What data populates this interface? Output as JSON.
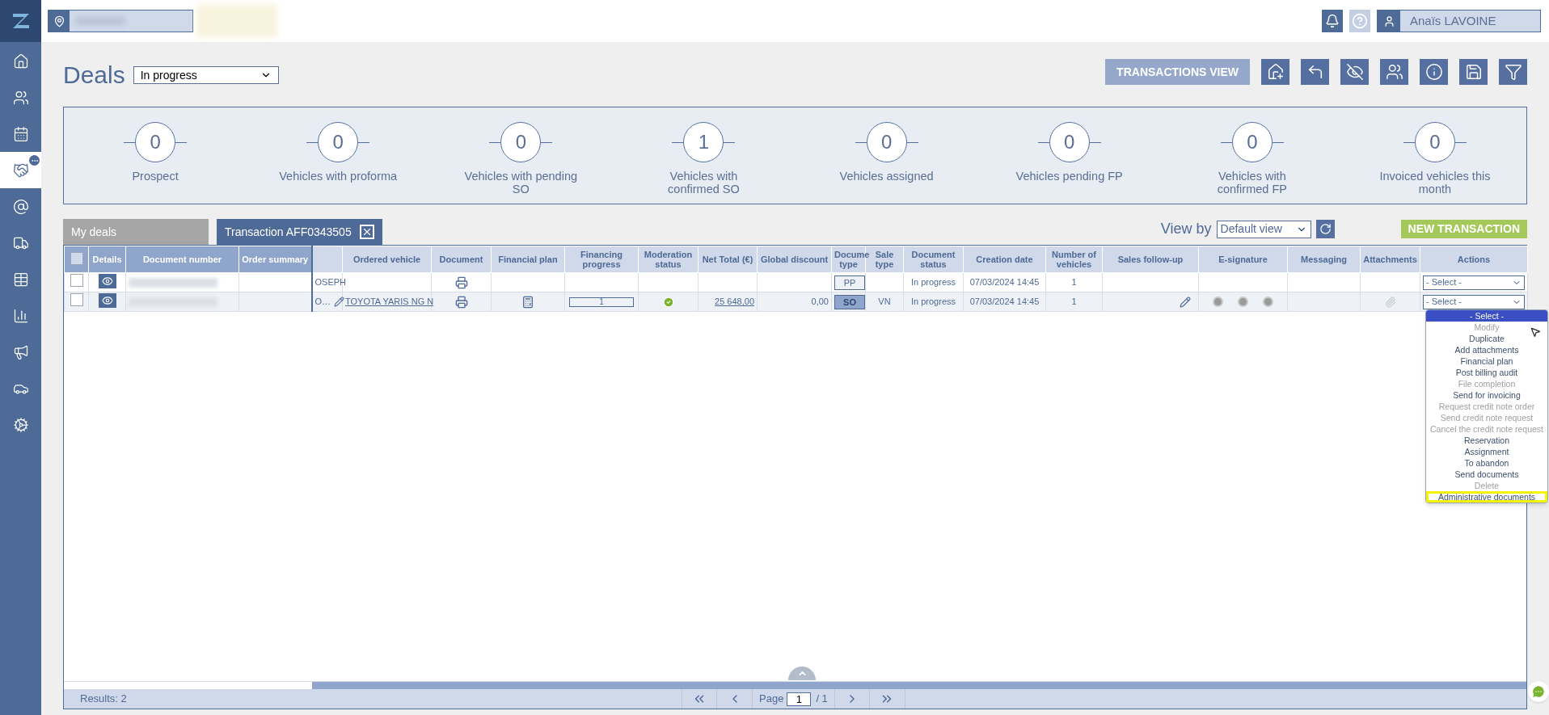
{
  "top_bar": {
    "user_name": "Anaïs LAVOINE"
  },
  "sidebar": {
    "items": [
      {
        "kind": "home",
        "selected": false
      },
      {
        "kind": "contacts",
        "selected": false
      },
      {
        "kind": "calendar",
        "selected": false
      },
      {
        "kind": "deals",
        "selected": true,
        "badge": true
      },
      {
        "kind": "mail",
        "selected": false
      },
      {
        "kind": "fleet",
        "selected": false
      },
      {
        "kind": "table",
        "selected": false
      },
      {
        "kind": "stats",
        "selected": false
      },
      {
        "kind": "marketing",
        "selected": false
      },
      {
        "kind": "vehicle",
        "selected": false
      },
      {
        "kind": "settings",
        "selected": false
      }
    ]
  },
  "header": {
    "title": "Deals",
    "status_filter": "In progress",
    "view_button": "TRANSACTIONS VIEW",
    "tools": [
      {
        "kind": "export"
      },
      {
        "kind": "back"
      },
      {
        "kind": "hide"
      },
      {
        "kind": "team"
      },
      {
        "kind": "info"
      },
      {
        "kind": "save"
      },
      {
        "kind": "filter"
      }
    ]
  },
  "stats": [
    {
      "count": "0",
      "label": "Prospect"
    },
    {
      "count": "0",
      "label": "Vehicles with proforma"
    },
    {
      "count": "0",
      "label": "Vehicles with pending SO"
    },
    {
      "count": "1",
      "label": "Vehicles with confirmed SO"
    },
    {
      "count": "0",
      "label": "Vehicles assigned"
    },
    {
      "count": "0",
      "label": "Vehicles pending FP"
    },
    {
      "count": "0",
      "label": "Vehicles with confirmed FP"
    },
    {
      "count": "0",
      "label": "Invoiced vehicles this month"
    }
  ],
  "tabs": [
    {
      "label": "My deals",
      "selected": false,
      "closable": false
    },
    {
      "label": "Transaction AFF0343505",
      "selected": true,
      "closable": true
    }
  ],
  "view_by": {
    "label": "View by",
    "value": "Default view"
  },
  "new_button": "NEW TRANSACTION",
  "table": {
    "columns": [
      {
        "kind": "checkbox",
        "frozen": true
      },
      {
        "label": "Details",
        "frozen": true
      },
      {
        "label": "Document number",
        "frozen": true
      },
      {
        "label": "Order summary",
        "frozen": true
      },
      {
        "kind": "blank",
        "frozen": false
      },
      {
        "label": "Ordered vehicle",
        "frozen": false
      },
      {
        "label": "Document",
        "frozen": false
      },
      {
        "label": "Financial plan",
        "frozen": false
      },
      {
        "label": "Financing progress",
        "frozen": false
      },
      {
        "label": "Moderation status",
        "frozen": false
      },
      {
        "label": "Net Total (€)",
        "frozen": false
      },
      {
        "label": "Global discount",
        "frozen": false
      },
      {
        "label": "Docume type",
        "frozen": false
      },
      {
        "label": "Sale type",
        "frozen": false
      },
      {
        "label": "Document status",
        "frozen": false
      },
      {
        "label": "Creation date",
        "frozen": false
      },
      {
        "label": "Number of vehicles",
        "frozen": false
      },
      {
        "label": "Sales follow-up",
        "frozen": false
      },
      {
        "label": "E-signature",
        "frozen": false
      },
      {
        "label": "Messaging",
        "frozen": false
      },
      {
        "label": "Attachments",
        "frozen": false
      },
      {
        "label": "Actions",
        "frozen": false
      }
    ],
    "rows": [
      {
        "cells": [
          {
            "kind": "checkbox",
            "checked": false
          },
          {
            "kind": "details"
          },
          {
            "kind": "redacted"
          },
          {
            "kind": "empty"
          },
          {
            "kind": "clip",
            "text": "OSEPH"
          },
          {
            "kind": "empty"
          },
          {
            "kind": "print"
          },
          {
            "kind": "empty"
          },
          {
            "kind": "empty"
          },
          {
            "kind": "empty"
          },
          {
            "kind": "empty"
          },
          {
            "kind": "empty"
          },
          {
            "kind": "doc_type",
            "text": "PP",
            "selected": false
          },
          {
            "kind": "empty"
          },
          {
            "kind": "text",
            "text": "In progress"
          },
          {
            "kind": "text",
            "text": "07/03/2024 14:45"
          },
          {
            "kind": "text",
            "text": "1"
          },
          {
            "kind": "empty"
          },
          {
            "kind": "empty"
          },
          {
            "kind": "empty"
          },
          {
            "kind": "empty"
          },
          {
            "kind": "select",
            "text": "- Select -",
            "open": false
          }
        ]
      },
      {
        "cells": [
          {
            "kind": "checkbox",
            "checked": false
          },
          {
            "kind": "details"
          },
          {
            "kind": "redacted"
          },
          {
            "kind": "empty"
          },
          {
            "kind": "clip_edit",
            "text": "O…"
          },
          {
            "kind": "link",
            "text": "TOYOTA YARIS NG N"
          },
          {
            "kind": "print"
          },
          {
            "kind": "calculator"
          },
          {
            "kind": "progress",
            "text": "1",
            "level": 0
          },
          {
            "kind": "check"
          },
          {
            "kind": "link_right",
            "text": "25 648,00"
          },
          {
            "kind": "text_right",
            "text": "0,00"
          },
          {
            "kind": "doc_type",
            "text": "SO",
            "selected": true
          },
          {
            "kind": "text",
            "text": "VN"
          },
          {
            "kind": "text",
            "text": "In progress"
          },
          {
            "kind": "text",
            "text": "07/03/2024 14:45"
          },
          {
            "kind": "text",
            "text": "1"
          },
          {
            "kind": "edit"
          },
          {
            "kind": "esign"
          },
          {
            "kind": "empty"
          },
          {
            "kind": "attachment"
          },
          {
            "kind": "select",
            "text": "- Select -",
            "open": true
          }
        ]
      }
    ]
  },
  "actions_menu": [
    {
      "label": "- Select -",
      "selected": true,
      "disabled": false,
      "highlighted": false
    },
    {
      "label": "Modify",
      "selected": false,
      "disabled": true,
      "highlighted": false
    },
    {
      "label": "Duplicate",
      "selected": false,
      "disabled": false,
      "highlighted": false
    },
    {
      "label": "Add attachments",
      "selected": false,
      "disabled": false,
      "highlighted": false
    },
    {
      "label": "Financial plan",
      "selected": false,
      "disabled": false,
      "highlighted": false
    },
    {
      "label": "Post billing audit",
      "selected": false,
      "disabled": false,
      "highlighted": false
    },
    {
      "label": "File completion",
      "selected": false,
      "disabled": true,
      "highlighted": false
    },
    {
      "label": "Send for invoicing",
      "selected": false,
      "disabled": false,
      "highlighted": false
    },
    {
      "label": "Request credit note order",
      "selected": false,
      "disabled": true,
      "highlighted": false
    },
    {
      "label": "Send credit note request",
      "selected": false,
      "disabled": true,
      "highlighted": false
    },
    {
      "label": "Cancel the credit note request",
      "selected": false,
      "disabled": true,
      "highlighted": false
    },
    {
      "label": "Reservation",
      "selected": false,
      "disabled": false,
      "highlighted": false
    },
    {
      "label": "Assignment",
      "selected": false,
      "disabled": false,
      "highlighted": false
    },
    {
      "label": "To abandon",
      "selected": false,
      "disabled": false,
      "highlighted": false
    },
    {
      "label": "Send documents",
      "selected": false,
      "disabled": false,
      "highlighted": false
    },
    {
      "label": "Delete",
      "selected": false,
      "disabled": true,
      "highlighted": false
    },
    {
      "label": "Administrative documents",
      "selected": false,
      "disabled": false,
      "highlighted": true
    }
  ],
  "footer": {
    "results": "Results: 2",
    "page_label": "Page",
    "page": "1",
    "page_total": "/ 1"
  }
}
